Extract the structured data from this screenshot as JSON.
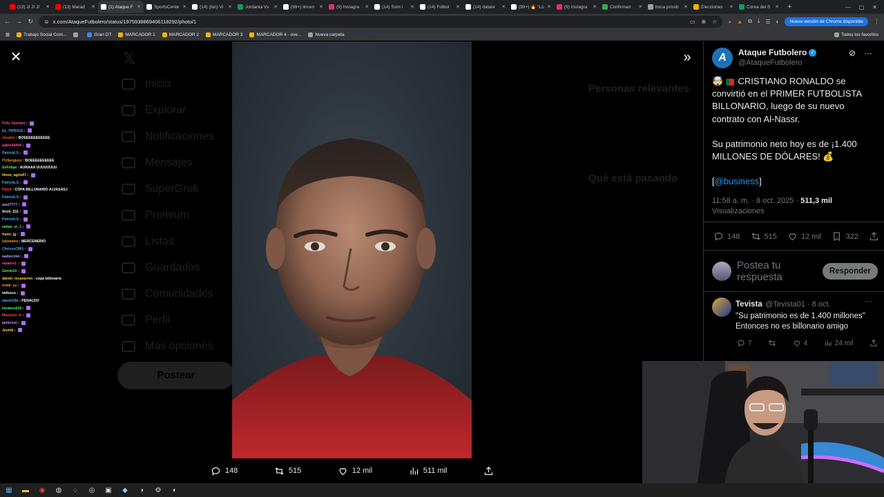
{
  "browser": {
    "tabs": [
      {
        "title": "(13) JI JI JI",
        "color": "#ff0000"
      },
      {
        "title": "(13) Marad",
        "color": "#ff0000"
      },
      {
        "title": "(1) Ataque F",
        "color": "#ffffff",
        "active": true
      },
      {
        "title": "SportsCente",
        "color": "#ffffff"
      },
      {
        "title": "(14) (fan) Vi",
        "color": "#ffffff"
      },
      {
        "title": "Jordania Vs",
        "color": "#0f9d58"
      },
      {
        "title": "(99+) lincen",
        "color": "#ffffff"
      },
      {
        "title": "(9) Instagra",
        "color": "#e1306c"
      },
      {
        "title": "(14) Som l",
        "color": "#ffffff"
      },
      {
        "title": "(14) Fútbol",
        "color": "#ffffff"
      },
      {
        "title": "(14) datare",
        "color": "#ffffff"
      },
      {
        "title": "(99+) 🔥 \"Lo",
        "color": "#ffffff"
      },
      {
        "title": "(9) Instagra",
        "color": "#e1306c"
      },
      {
        "title": "Confirmad",
        "color": "#34a853"
      },
      {
        "title": "boca prosib",
        "color": "#9aa0a6"
      },
      {
        "title": "Elecciones",
        "color": "#f4b400"
      },
      {
        "title": "Corea del S",
        "color": "#0f9d58"
      }
    ],
    "url": "x.com/AtaqueFutbolero/status/1975938869406118292/photo/1",
    "update_label": "Nueva versión de Chrome disponible",
    "bookmarks": [
      {
        "label": "Trabajo Social Com...",
        "color": "#f4b400"
      },
      {
        "label": "",
        "color": "#9aa0a6"
      },
      {
        "label": "Gran DT",
        "color": "#4285f4"
      },
      {
        "label": "MARCADOR 1",
        "color": "#f4b400"
      },
      {
        "label": "MARCADOR 2",
        "color": "#f4b400"
      },
      {
        "label": "MARCADOR 3",
        "color": "#f4b400"
      },
      {
        "label": "MARCADOR 4 - ove...",
        "color": "#f4b400"
      },
      {
        "label": "Nueva carpeta",
        "color": "#9aa0a6"
      }
    ],
    "all_bookmarks_label": "Todos los favoritos"
  },
  "background": {
    "nav": [
      "Inicio",
      "Explorar",
      "Notificaciones",
      "Mensajes",
      "SuperGrok",
      "Premium",
      "Listas",
      "Guardados",
      "Comunidades",
      "Perfil",
      "Más opciones"
    ],
    "post_label": "Postear",
    "relevant_people": "Personas relevantes",
    "whats_happening": "Qué está pasando"
  },
  "chat": [
    {
      "user": "Trifu_Nonano",
      "color": "#ff4fa0",
      "msg": ""
    },
    {
      "user": "EL_PIPE61E",
      "color": "#3bb0ff",
      "msg": ""
    },
    {
      "user": "Jesakio",
      "color": "#ff4444",
      "msg": "BOEEEEEEEEEEE"
    },
    {
      "user": "pablo44444",
      "color": "#ff4fa0",
      "msg": ""
    },
    {
      "user": "PatrickLS",
      "color": "#3bb0ff",
      "msg": ""
    },
    {
      "user": "ITzSergiozz",
      "color": "#ff9a3c",
      "msg": "BOEEEEEEEEEE"
    },
    {
      "user": "SsFelipe",
      "color": "#4cff7a",
      "msg": "AURAAA UUUUUUUU"
    },
    {
      "user": "limon_agrio67",
      "color": "#ffd84a",
      "msg": ""
    },
    {
      "user": "PatrickLS",
      "color": "#3bb0ff",
      "msg": ""
    },
    {
      "user": "Pibe9",
      "color": "#ff4444",
      "msg": "COPA BILLONARIO AJJASASJ"
    },
    {
      "user": "PatrickLS",
      "color": "#3bb0ff",
      "msg": ""
    },
    {
      "user": "paul7777",
      "color": "#c89bff",
      "msg": ""
    },
    {
      "user": "ferch_511",
      "color": "#ffffff",
      "msg": ""
    },
    {
      "user": "PatrickLS",
      "color": "#3bb0ff",
      "msg": ""
    },
    {
      "user": "sebas_vr_1",
      "color": "#4cff7a",
      "msg": ""
    },
    {
      "user": "frann_jg",
      "color": "#ffd84a",
      "msg": ""
    },
    {
      "user": "lybostero",
      "color": "#ff9a3c",
      "msg": "MERCENERIO"
    },
    {
      "user": "ChrissoCMG",
      "color": "#3bb0ff",
      "msg": ""
    },
    {
      "user": "walterciim",
      "color": "#c89bff",
      "msg": ""
    },
    {
      "user": "elpatos1",
      "color": "#ff4fa0",
      "msg": ""
    },
    {
      "user": "Geroo14",
      "color": "#4cff7a",
      "msg": ""
    },
    {
      "user": "daniel_recavarren",
      "color": "#ffd84a",
      "msg": "copa billonario"
    },
    {
      "user": "trolik_ss",
      "color": "#ff9a3c",
      "msg": ""
    },
    {
      "user": "imfosco",
      "color": "#ffffff",
      "msg": ""
    },
    {
      "user": "daniel18a",
      "color": "#3bb0ff",
      "msg": "PENALDO"
    },
    {
      "user": "lucascod10",
      "color": "#4cff7a",
      "msg": ""
    },
    {
      "user": "Mauuiyu_m",
      "color": "#ff4444",
      "msg": ""
    },
    {
      "user": "javiersoj",
      "color": "#c89bff",
      "msg": ""
    },
    {
      "user": "Jesirik",
      "color": "#ffd84a",
      "msg": ""
    }
  ],
  "photo_actions": {
    "replies": "148",
    "reposts": "515",
    "likes": "12 mil",
    "views": "511 mil"
  },
  "tweet": {
    "author_name": "Ataque Futbolero",
    "author_handle": "@AtaqueFutbolero",
    "text_1": "CRISTIANO RONALDO se convirtió en el PRIMER FUTBOLISTA BILLONARIO, luego de su nuevo contrato con Al-Nassr.",
    "text_2": "Su patrimonio neto hoy es de ¡1.400 MILLONES DE DÓLARES!",
    "link": "@business",
    "time": "11:58 a. m. · 8 oct. 2025 · ",
    "views_count": "511,3 mil",
    "views_label": "Visualizaciones",
    "stats": {
      "replies": "148",
      "reposts": "515",
      "likes": "12 mil",
      "bookmarks": "322"
    },
    "reply_placeholder": "Postea tu respuesta",
    "reply_button": "Responder"
  },
  "reply": {
    "name": "Tevista",
    "handle": "@Tevista01 · 8 oct.",
    "body": "\"Su patrimonio es de 1.400 millones\" Entonces no es billonario amigo",
    "replies": "7",
    "likes": "4",
    "views": "24 mil"
  },
  "colors": {
    "accent": "#1d9bf0",
    "text": "#e7e9ea",
    "muted": "#71767b"
  }
}
